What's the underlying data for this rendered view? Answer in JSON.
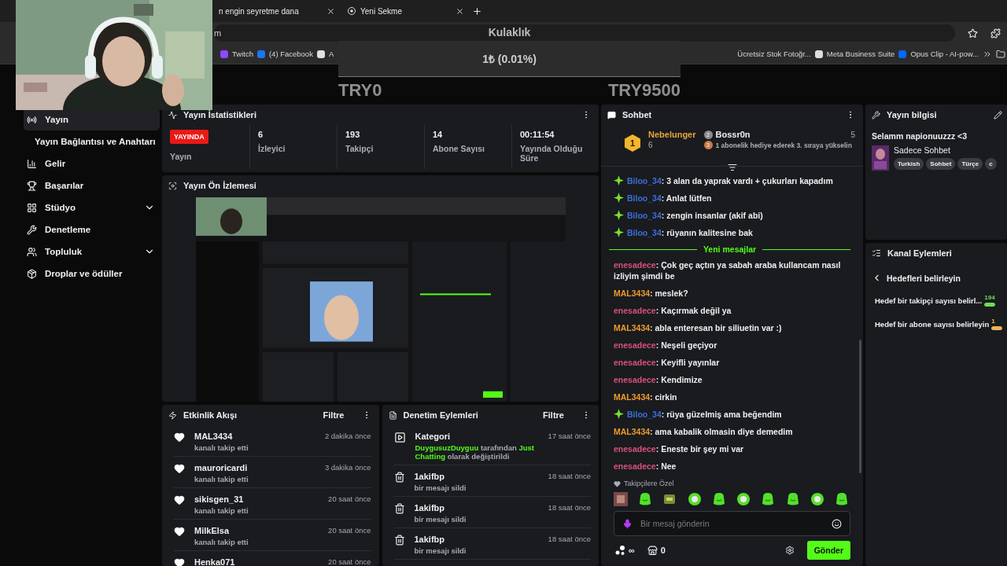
{
  "browser": {
    "tabs": [
      {
        "title": "n engin seyretme dana"
      },
      {
        "title": "Yeni Sekme"
      }
    ],
    "address": "m",
    "bookmarks_left": [
      "Twitch",
      "(4) Facebook",
      "A"
    ],
    "bookmarks_right": [
      "Ücretsiz Stok Fotoğr...",
      "Meta Business Suite",
      "Opus Clip - AI-pow..."
    ]
  },
  "goal_overlay": {
    "title": "Kulaklık",
    "amount": "1₺ (0.01%)",
    "level": 0.0001,
    "min": "TRY0",
    "max": "TRY9500"
  },
  "sidebar": {
    "items": [
      {
        "label": "Yayın",
        "selected": true,
        "children": [
          {
            "label": "Yayın Bağlantısı ve Anahtarı",
            "selected": false
          }
        ]
      },
      {
        "label": "Gelir",
        "selected": false
      },
      {
        "label": "Başarılar",
        "selected": false
      },
      {
        "label": "Stüdyo",
        "selected": false,
        "expanded": false
      },
      {
        "label": "Denetleme",
        "selected": false
      },
      {
        "label": "Topluluk",
        "selected": false,
        "expanded": false
      },
      {
        "label": "Droplar ve ödüller",
        "selected": false
      }
    ]
  },
  "stats": {
    "title": "Yayın İstatistikleri",
    "status": {
      "badge": "YAYINDA",
      "label": "Yayın"
    },
    "items": [
      {
        "value": "6",
        "label": "İzleyici"
      },
      {
        "value": "193",
        "label": "Takipçi"
      },
      {
        "value": "14",
        "label": "Abone Sayısı"
      },
      {
        "value": "00:11:54",
        "label": "Yayında Olduğu Süre"
      }
    ]
  },
  "preview": {
    "title": "Yayın Ön İzlemesi"
  },
  "activity": {
    "title": "Etkinlik Akışı",
    "filter": "Filtre",
    "items": [
      {
        "name": "MAL3434",
        "action": "kanalı takip etti",
        "time": "2 dakika önce"
      },
      {
        "name": "mauroricardi",
        "action": "kanalı takip etti",
        "time": "3 dakika önce"
      },
      {
        "name": "sikisgen_31",
        "action": "kanalı takip etti",
        "time": "20 saat önce"
      },
      {
        "name": "MilkElsa",
        "action": "kanalı takip etti",
        "time": "20 saat önce"
      },
      {
        "name": "Henka071",
        "time": "20 saat önce"
      }
    ]
  },
  "moderation": {
    "title": "Denetim Eylemleri",
    "filter": "Filtre",
    "items": [
      {
        "kind": "category",
        "title": "Kategori",
        "detail": "**DuygusuzDuyguu** tarafından **Just Chatting** olarak değiştirildi",
        "time": "17 saat önce"
      },
      {
        "kind": "delete",
        "title": "1akifbp",
        "detail": "bir mesajı sildi",
        "time": "18 saat önce"
      },
      {
        "kind": "delete",
        "title": "1akifbp",
        "detail": "bir mesajı sildi",
        "time": "18 saat önce"
      },
      {
        "kind": "delete",
        "title": "1akifbp",
        "detail": "bir mesajı sildi",
        "time": "18 saat önce"
      }
    ]
  },
  "chat": {
    "title": "Sohbet",
    "leaders": [
      {
        "rank": "1",
        "name": "Nebelunger",
        "count": "6"
      },
      {
        "rank": "2",
        "name": "Bossr0n",
        "count": "5"
      }
    ],
    "leader_hint": {
      "rank": "3",
      "text": "1 abonelik hediye ederek 3. sıraya yükselin"
    },
    "messages": [
      {
        "kind": "message",
        "user": "Biloo_34",
        "color": "#3b6fd9",
        "badge": true,
        "text": ": 3 alan da yaprak vardı + çukurları kapadım"
      },
      {
        "kind": "message",
        "user": "Biloo_34",
        "color": "#3b6fd9",
        "badge": true,
        "text": ": Anlat lütfen"
      },
      {
        "kind": "message",
        "user": "Biloo_34",
        "color": "#3b6fd9",
        "badge": true,
        "text": ": zengin insanlar (akif abi)"
      },
      {
        "kind": "message",
        "user": "Biloo_34",
        "color": "#3b6fd9",
        "badge": true,
        "text": ": rüyanın kalitesine bak"
      },
      {
        "kind": "divider",
        "text": "Yeni mesajlar"
      },
      {
        "kind": "message",
        "user": "enesadece",
        "color": "#d9507c",
        "badge": false,
        "text": ": Çok geç açtın ya sabah araba kullancam nasıl izliyim şimdi be"
      },
      {
        "kind": "message",
        "user": "MAL3434",
        "color": "#f09a2a",
        "badge": false,
        "text": ": meslek?"
      },
      {
        "kind": "message",
        "user": "enesadece",
        "color": "#d9507c",
        "badge": false,
        "text": ": Kaçırmak değil ya"
      },
      {
        "kind": "message",
        "user": "MAL3434",
        "color": "#f09a2a",
        "badge": false,
        "text": ": abla enteresan bir siliuetin var :)"
      },
      {
        "kind": "message",
        "user": "enesadece",
        "color": "#d9507c",
        "badge": false,
        "text": ": Neşeli geçiyor"
      },
      {
        "kind": "message",
        "user": "enesadece",
        "color": "#d9507c",
        "badge": false,
        "text": ": Keyifli yayınlar"
      },
      {
        "kind": "message",
        "user": "enesadece",
        "color": "#d9507c",
        "badge": false,
        "text": ": Kendimize"
      },
      {
        "kind": "message",
        "user": "MAL3434",
        "color": "#f09a2a",
        "badge": false,
        "text": ": cirkin"
      },
      {
        "kind": "message",
        "user": "Biloo_34",
        "color": "#3b6fd9",
        "badge": true,
        "text": ": rüya güzelmiş ama beğendim"
      },
      {
        "kind": "message",
        "user": "MAL3434",
        "color": "#f09a2a",
        "badge": false,
        "text": ": ama kabalik olmasin diye demedim"
      },
      {
        "kind": "message",
        "user": "enesadece",
        "color": "#d9507c",
        "badge": false,
        "text": ": Eneste bir şey mi var"
      },
      {
        "kind": "message",
        "user": "enesadece",
        "color": "#d9507c",
        "badge": false,
        "text": ": Nee"
      }
    ],
    "followers_only": "Takipçilere Özel",
    "emotes": [
      {
        "kind": "picture"
      },
      {
        "kind": "blob"
      },
      {
        "kind": "square"
      },
      {
        "kind": "round"
      },
      {
        "kind": "blob"
      },
      {
        "kind": "round"
      },
      {
        "kind": "blob"
      },
      {
        "kind": "blob"
      },
      {
        "kind": "round"
      },
      {
        "kind": "blob"
      }
    ],
    "input": {
      "placeholder": "Bir mesaj gönderin"
    },
    "points": "∞",
    "store_count": "0",
    "send": "Gönder"
  },
  "stream_info": {
    "title": "Yayın bilgisi",
    "stream_title": "Selamm napionuuzzz <3",
    "category": "Sadece Sohbet",
    "tags": [
      "Turkish",
      "Sohbet",
      "Türçe",
      "c"
    ]
  },
  "channel_actions": {
    "title": "Kanal Eylemleri",
    "back": "Hedefleri belirleyin",
    "goals": [
      {
        "label": "Hedef bir takipçi sayısı belirl...",
        "count": "194",
        "level": 1,
        "color": "#6fdc4f"
      },
      {
        "label": "Hedef bir abone sayısı belirleyin",
        "count": "1",
        "level": 1,
        "color": "#f0b45a"
      }
    ]
  }
}
